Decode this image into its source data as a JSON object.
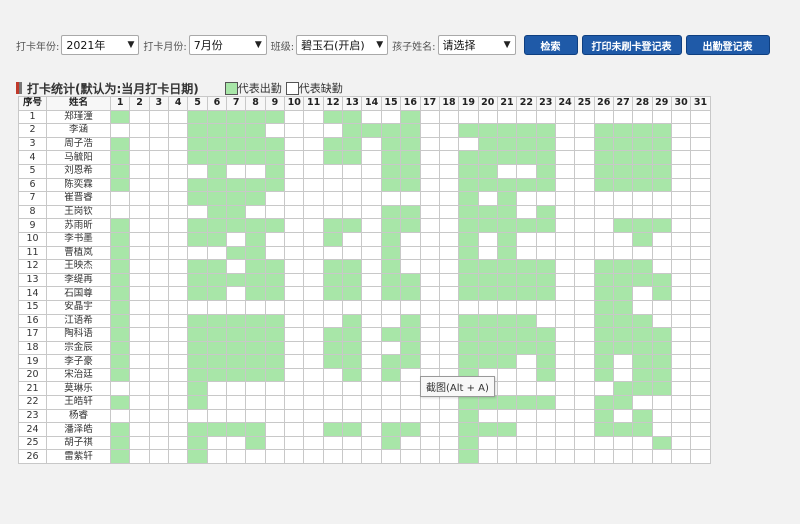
{
  "filters": {
    "year_label": "打卡年份:",
    "year_value": "2021年",
    "month_label": "打卡月份:",
    "month_value": "7月份",
    "class_label": "班级:",
    "class_value": "碧玉石(开启)",
    "child_label": "孩子姓名:",
    "child_value": "请选择"
  },
  "buttons": {
    "search": "检索",
    "print_unswiped": "打印未刷卡登记表",
    "attendance": "出勤登记表"
  },
  "section": {
    "title": "打卡统计(默认为:当月打卡日期)",
    "legend_present": "代表出勤",
    "legend_absent": "代表缺勤"
  },
  "colors": {
    "present": "#a8e6a8",
    "absent": "#ffffff",
    "button": "#1f5aa8",
    "title_mark_left": "#c0392b",
    "title_mark_right": "#777777"
  },
  "table": {
    "headers": {
      "seq": "序号",
      "name": "姓名"
    },
    "days": [
      "1",
      "2",
      "3",
      "4",
      "5",
      "6",
      "7",
      "8",
      "9",
      "10",
      "11",
      "12",
      "13",
      "14",
      "15",
      "16",
      "17",
      "18",
      "19",
      "20",
      "21",
      "22",
      "23",
      "24",
      "25",
      "26",
      "27",
      "28",
      "29",
      "30",
      "31"
    ],
    "rows": [
      {
        "seq": "1",
        "name": "郑瑾潼",
        "present": [
          1,
          5,
          6,
          7,
          8,
          9,
          12,
          13,
          16
        ]
      },
      {
        "seq": "2",
        "name": "李涵",
        "present": [
          5,
          6,
          7,
          8,
          13,
          14,
          15,
          16,
          19,
          20,
          21,
          22,
          23,
          26,
          27,
          28,
          29
        ]
      },
      {
        "seq": "3",
        "name": "周子浩",
        "present": [
          1,
          5,
          6,
          7,
          8,
          9,
          12,
          13,
          15,
          16,
          20,
          21,
          22,
          23,
          26,
          27,
          28,
          29
        ]
      },
      {
        "seq": "4",
        "name": "马毓阳",
        "present": [
          1,
          5,
          6,
          7,
          8,
          9,
          12,
          13,
          15,
          16,
          19,
          20,
          21,
          22,
          23,
          26,
          27,
          28,
          29
        ]
      },
      {
        "seq": "5",
        "name": "刘恩希",
        "present": [
          1,
          6,
          9,
          15,
          16,
          19,
          20,
          23,
          26,
          27,
          28,
          29
        ]
      },
      {
        "seq": "6",
        "name": "陈奕霖",
        "present": [
          1,
          5,
          6,
          7,
          8,
          9,
          15,
          16,
          19,
          20,
          21,
          22,
          23,
          26,
          27,
          28,
          29
        ]
      },
      {
        "seq": "7",
        "name": "崔晋睿",
        "present": [
          5,
          6,
          7,
          8,
          19,
          21
        ]
      },
      {
        "seq": "8",
        "name": "王岗钦",
        "present": [
          6,
          7,
          15,
          16,
          19,
          20,
          21,
          23
        ]
      },
      {
        "seq": "9",
        "name": "苏雨昕",
        "present": [
          1,
          5,
          6,
          7,
          8,
          9,
          12,
          13,
          15,
          16,
          19,
          20,
          21,
          22,
          23,
          27,
          28,
          29
        ]
      },
      {
        "seq": "10",
        "name": "李书墨",
        "present": [
          1,
          5,
          6,
          8,
          12,
          15,
          19,
          21,
          28
        ]
      },
      {
        "seq": "11",
        "name": "曹植岚",
        "present": [
          1,
          7,
          8,
          15,
          19,
          21
        ]
      },
      {
        "seq": "12",
        "name": "王映杰",
        "present": [
          1,
          5,
          6,
          8,
          9,
          12,
          13,
          15,
          19,
          20,
          21,
          22,
          23,
          26,
          27,
          28
        ]
      },
      {
        "seq": "13",
        "name": "李缇再",
        "present": [
          1,
          5,
          6,
          7,
          8,
          9,
          12,
          13,
          15,
          16,
          19,
          20,
          21,
          22,
          23,
          26,
          27,
          28,
          29
        ]
      },
      {
        "seq": "14",
        "name": "石国尊",
        "present": [
          1,
          5,
          6,
          8,
          9,
          12,
          13,
          15,
          16,
          19,
          20,
          21,
          22,
          23,
          26,
          27,
          29
        ]
      },
      {
        "seq": "15",
        "name": "安晶宇",
        "present": [
          1,
          26,
          27
        ]
      },
      {
        "seq": "16",
        "name": "江语希",
        "present": [
          1,
          5,
          6,
          7,
          8,
          9,
          13,
          16,
          19,
          20,
          21,
          22,
          26,
          27,
          28
        ]
      },
      {
        "seq": "17",
        "name": "陶科语",
        "present": [
          1,
          5,
          6,
          7,
          8,
          9,
          12,
          13,
          15,
          16,
          19,
          20,
          21,
          22,
          23,
          26,
          27,
          28,
          29
        ]
      },
      {
        "seq": "18",
        "name": "宗金辰",
        "present": [
          1,
          5,
          6,
          7,
          8,
          9,
          12,
          13,
          16,
          19,
          20,
          21,
          22,
          23,
          26,
          27,
          28,
          29
        ]
      },
      {
        "seq": "19",
        "name": "李子豪",
        "present": [
          1,
          5,
          6,
          7,
          8,
          9,
          12,
          13,
          15,
          16,
          19,
          20,
          21,
          23,
          26,
          28,
          29
        ]
      },
      {
        "seq": "20",
        "name": "宋治廷",
        "present": [
          1,
          5,
          6,
          7,
          8,
          9,
          13,
          15,
          19,
          23,
          26,
          28,
          29
        ]
      },
      {
        "seq": "21",
        "name": "莫琳乐",
        "present": [
          5,
          19,
          27,
          28,
          29
        ]
      },
      {
        "seq": "22",
        "name": "王皓轩",
        "present": [
          1,
          5,
          19,
          20,
          21,
          22,
          23,
          26,
          27
        ]
      },
      {
        "seq": "23",
        "name": "杨睿",
        "present": [
          19,
          26,
          28
        ]
      },
      {
        "seq": "24",
        "name": "潘泽皓",
        "present": [
          1,
          5,
          6,
          7,
          8,
          12,
          13,
          15,
          16,
          19,
          20,
          21,
          26,
          27,
          28
        ]
      },
      {
        "seq": "25",
        "name": "胡子祺",
        "present": [
          1,
          5,
          8,
          15,
          19,
          29
        ]
      },
      {
        "seq": "26",
        "name": "雷紫轩",
        "present": [
          1,
          5,
          19
        ]
      }
    ]
  },
  "tooltip": {
    "text": "截图(Alt + A)"
  }
}
